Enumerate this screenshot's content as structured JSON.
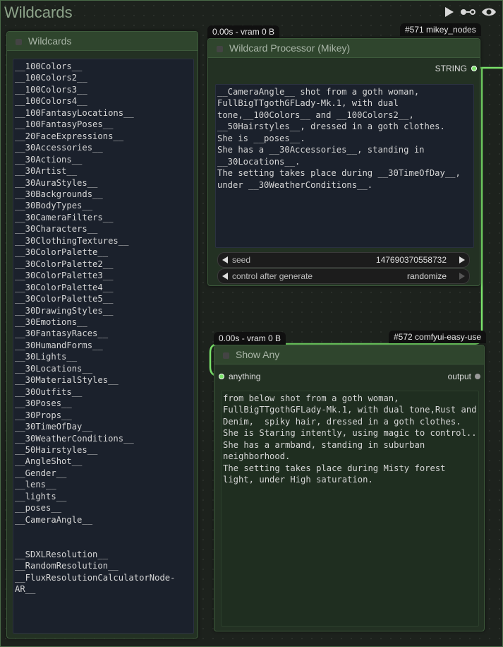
{
  "group": {
    "title": "Wildcards",
    "icons": [
      "play-icon",
      "link-icon",
      "eye-icon"
    ]
  },
  "wildcards_node": {
    "title": "Wildcards",
    "text": "__100Colors__\n__100Colors2__\n__100Colors3__\n__100Colors4__\n__100FantasyLocations__\n__100FantasyPoses__\n__20FaceExpressions__\n__30Accessories__\n__30Actions__\n__30Artist__\n__30AuraStyles__\n__30Backgrounds__\n__30BodyTypes__\n__30CameraFilters__\n__30Characters__\n__30ClothingTextures__\n__30ColorPalette__\n__30ColorPalette2__\n__30ColorPalette3__\n__30ColorPalette4__\n__30ColorPalette5__\n__30DrawingStyles__\n__30Emotions__\n__30FantasyRaces__\n__30HumandForms__\n__30Lights__\n__30Locations__\n__30MaterialStyles__\n__30Outfits__\n__30Poses__\n__30Props__\n__30TimeOfDay__\n__30WeatherConditions__\n__50Hairstyles__\n__AngleShot__\n__Gender__\n__lens__\n__lights__\n__poses__\n__CameraAngle__\n\n\n__SDXLResolution__\n__RandomResolution__\n__FluxResolutionCalculatorNode-AR__"
  },
  "processor_node": {
    "title": "Wildcard Processor (Mikey)",
    "timing_badge": "0.00s - vram 0 B",
    "id_badge": "#571 mikey_nodes",
    "output_label": "STRING",
    "text": "__CameraAngle__ shot from a goth woman, FullBigTTgothGFLady-Mk.1, with dual tone,__100Colors__ and __100Colors2__, __50Hairstyles__, dressed in a goth clothes.\nShe is __poses__.\nShe has a __30Accessories__, standing in __30Locations__.\nThe setting takes place during __30TimeOfDay__, under __30WeatherConditions__.",
    "seed": {
      "label": "seed",
      "value": "147690370558732"
    },
    "control": {
      "label": "control after generate",
      "value": "randomize"
    }
  },
  "show_any_node": {
    "title": "Show Any",
    "timing_badge": "0.00s - vram 0 B",
    "id_badge": "#572 comfyui-easy-use",
    "input_label": "anything",
    "output_label": "output",
    "text": "from below shot from a goth woman, FullBigTTgothGFLady-Mk.1, with dual tone,Rust and Denim,  spiky hair, dressed in a goth clothes.\nShe is Staring intently, using magic to control..\nShe has a armband, standing in suburban neighborhood.\nThe setting takes place during Misty forest light, under High saturation."
  },
  "colors": {
    "link": "#7be36b",
    "node_body": "#233123",
    "node_header": "#2f452d",
    "textarea_bg": "#1b212c"
  }
}
